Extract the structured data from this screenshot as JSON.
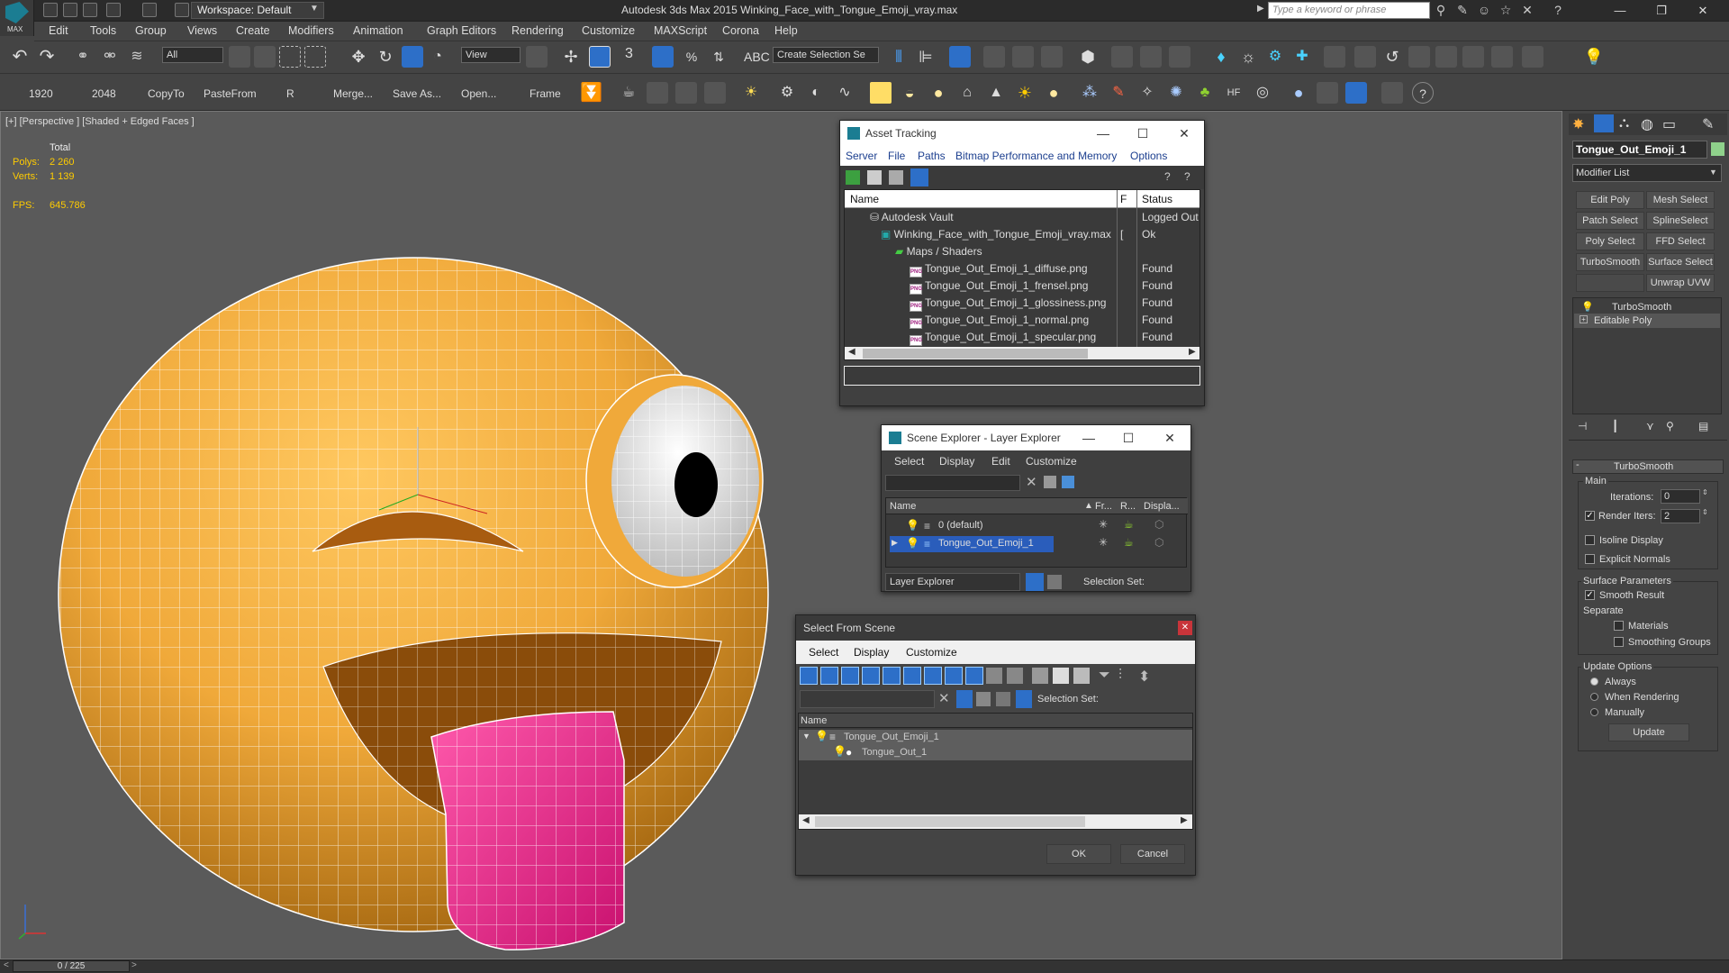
{
  "app": {
    "title": "Autodesk 3ds Max  2015    Winking_Face_with_Tongue_Emoji_vray.max",
    "logo_text": "MAX",
    "workspace": "Workspace: Default",
    "search_placeholder": "Type a keyword or phrase",
    "menu": [
      "Edit",
      "Tools",
      "Group",
      "Views",
      "Create",
      "Modifiers",
      "Animation",
      "Graph Editors",
      "Rendering",
      "Customize",
      "MAXScript",
      "Corona",
      "Help"
    ]
  },
  "toolbar": {
    "selection_filter": "All",
    "ref_coord": "View",
    "named_selection": "Create Selection Se",
    "snap_label": "3"
  },
  "toolbar2": {
    "items": [
      "1920",
      "2048",
      "CopyTo",
      "PasteFrom",
      "R",
      "Merge...",
      "Save As...",
      "Open...",
      "Frame"
    ]
  },
  "viewport": {
    "label": "[+] [Perspective ] [Shaded + Edged Faces ]",
    "stats_header": "Total",
    "polys_label": "Polys:",
    "polys_value": "2 260",
    "verts_label": "Verts:",
    "verts_value": "1 139",
    "fps_label": "FPS:",
    "fps_value": "645.786"
  },
  "asset_tracking": {
    "title": "Asset Tracking",
    "menu": [
      "Server",
      "File",
      "Paths",
      "Bitmap Performance and Memory",
      "Options"
    ],
    "columns": [
      "Name",
      "F",
      "Status"
    ],
    "rows": [
      {
        "name": "Autodesk Vault",
        "f": "",
        "status": "Logged Out"
      },
      {
        "name": "Winking_Face_with_Tongue_Emoji_vray.max",
        "f": "[",
        "status": "Ok"
      },
      {
        "name": "Maps / Shaders",
        "f": "",
        "status": ""
      },
      {
        "name": "Tongue_Out_Emoji_1_diffuse.png",
        "f": "",
        "status": "Found"
      },
      {
        "name": "Tongue_Out_Emoji_1_frensel.png",
        "f": "",
        "status": "Found"
      },
      {
        "name": "Tongue_Out_Emoji_1_glossiness.png",
        "f": "",
        "status": "Found"
      },
      {
        "name": "Tongue_Out_Emoji_1_normal.png",
        "f": "",
        "status": "Found"
      },
      {
        "name": "Tongue_Out_Emoji_1_specular.png",
        "f": "",
        "status": "Found"
      }
    ]
  },
  "scene_explorer": {
    "title": "Scene Explorer - Layer Explorer",
    "menu": [
      "Select",
      "Display",
      "Edit",
      "Customize"
    ],
    "columns": [
      "Name",
      "Fr...",
      "R...",
      "Displa..."
    ],
    "rows": [
      "0 (default)",
      "Tongue_Out_Emoji_1"
    ],
    "footer_dropdown": "Layer Explorer",
    "selection_set": "Selection Set:"
  },
  "select_from_scene": {
    "title": "Select From Scene",
    "menu": [
      "Select",
      "Display",
      "Customize"
    ],
    "selection_set": "Selection Set:",
    "column": "Name",
    "rows": [
      "Tongue_Out_Emoji_1",
      "Tongue_Out_1"
    ],
    "ok": "OK",
    "cancel": "Cancel"
  },
  "command_panel": {
    "object_name": "Tongue_Out_Emoji_1",
    "modifier_list": "Modifier List",
    "buttons": [
      "Edit Poly",
      "Mesh Select",
      "Patch Select",
      "SplineSelect",
      "Poly Select",
      "FFD Select",
      "TurboSmooth",
      "Surface Select",
      "Unwrap UVW"
    ],
    "stack": [
      "TurboSmooth",
      "Editable Poly"
    ],
    "rollout_title": "TurboSmooth",
    "main_label": "Main",
    "iterations_label": "Iterations:",
    "iterations_value": "0",
    "render_iters_label": "Render Iters:",
    "render_iters_value": "2",
    "isoline": "Isoline Display",
    "explicit_normals": "Explicit Normals",
    "surface_params": "Surface Parameters",
    "smooth_result": "Smooth Result",
    "separate": "Separate",
    "materials": "Materials",
    "smoothing_groups": "Smoothing Groups",
    "update_options": "Update Options",
    "always": "Always",
    "when_rendering": "When Rendering",
    "manually": "Manually",
    "update": "Update"
  },
  "status": {
    "frame": "0 / 225"
  },
  "colors": {
    "accent": "#1b7d92",
    "face": "#f0a93a",
    "tongue": "#e0308a",
    "selection": "#2a5dbb"
  }
}
